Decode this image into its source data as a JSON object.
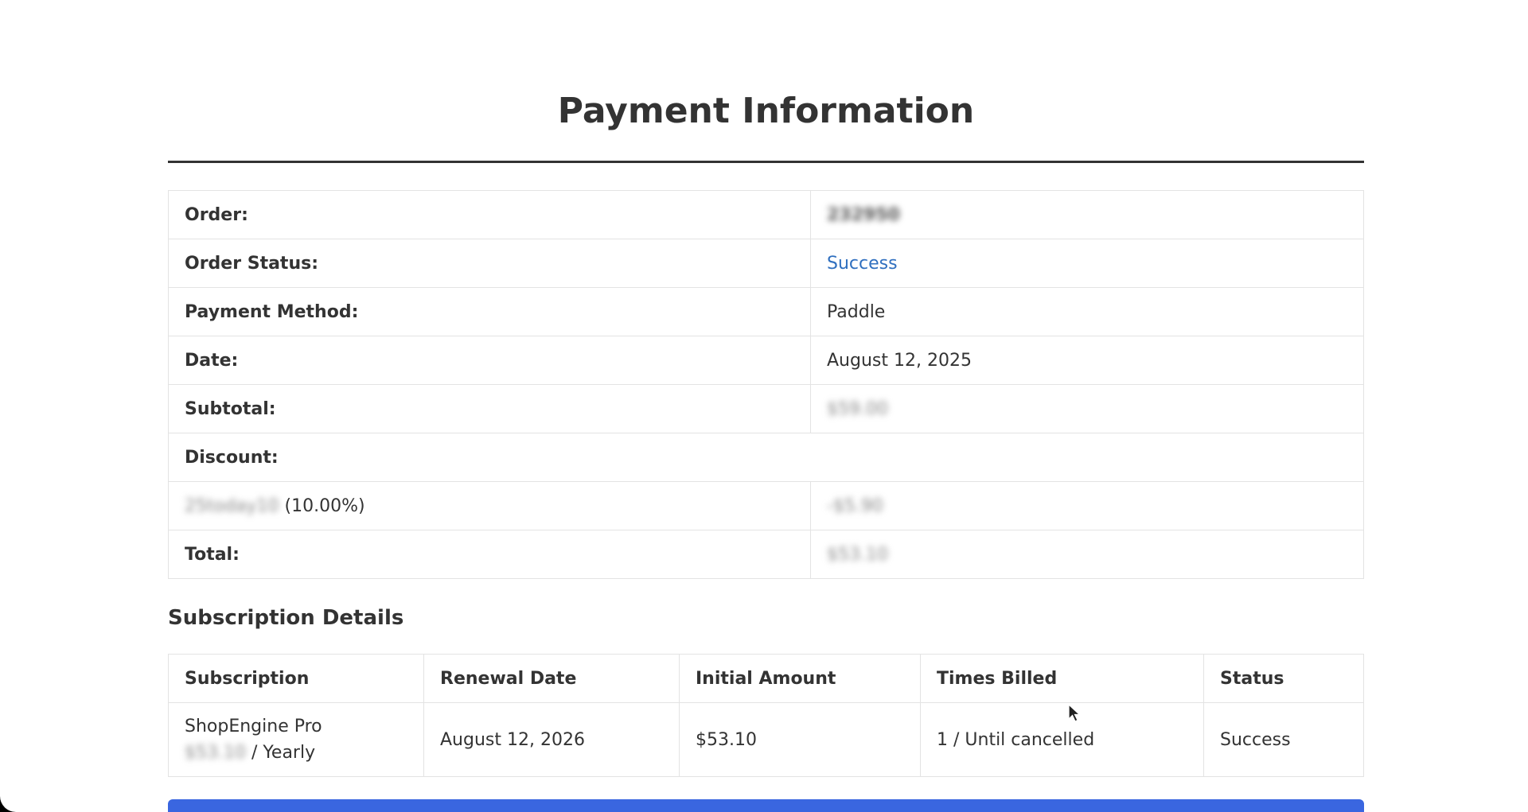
{
  "page_title": "Payment Information",
  "order_details": {
    "order_label": "Order:",
    "order_value": "232950",
    "status_label": "Order Status:",
    "status_value": "Success",
    "method_label": "Payment Method:",
    "method_value": "Paddle",
    "date_label": "Date:",
    "date_value": "August 12, 2025",
    "subtotal_label": "Subtotal:",
    "subtotal_value": "$59.00",
    "discount_label": "Discount:",
    "coupon_code": "25today10",
    "coupon_percent": "(10.00%)",
    "coupon_amount": "-$5.90",
    "total_label": "Total:",
    "total_value": "$53.10"
  },
  "subscription": {
    "heading": "Subscription Details",
    "columns": [
      "Subscription",
      "Renewal Date",
      "Initial Amount",
      "Times Billed",
      "Status"
    ],
    "row": {
      "product_name": "ShopEngine Pro",
      "price": "$53.10",
      "period": "/ Yearly",
      "renewal_date": "August 12, 2026",
      "initial_amount": "$53.10",
      "times_billed": "1 / Until cancelled",
      "status": "Success"
    }
  },
  "colors": {
    "status_link": "#2f6fbf",
    "accent_bar": "#3a66e0",
    "title_rule": "#333333"
  },
  "icons": {
    "cursor": "mouse-pointer-icon"
  }
}
